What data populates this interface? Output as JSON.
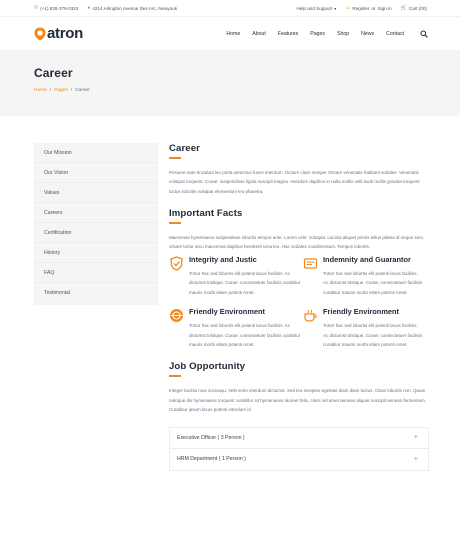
{
  "topbar": {
    "phone": "(+1) 828-376-0322",
    "address": "4214 Arlington Avenue Des Arc, Newyouk",
    "help": "Help and Support",
    "register": "Register",
    "or": "or",
    "signin": "Sign in",
    "cart": "Cart (00)"
  },
  "brand": {
    "name": "atron"
  },
  "nav": {
    "home": "Home",
    "about": "About",
    "features": "Features",
    "pages": "Pages",
    "shop": "Shop",
    "news": "News",
    "contact": "Contact"
  },
  "hero": {
    "title": "Career",
    "crumb_home": "Home",
    "crumb_pages": "Pages",
    "crumb_current": "Career",
    "sep": "/"
  },
  "sidebar": {
    "items": [
      {
        "label": "Our Mission"
      },
      {
        "label": "Our Vision"
      },
      {
        "label": "Values"
      },
      {
        "label": "Careers"
      },
      {
        "label": "Certification"
      },
      {
        "label": "History"
      },
      {
        "label": "FAQ"
      },
      {
        "label": "Testimonial"
      }
    ]
  },
  "career": {
    "title": "Career",
    "text": "Posuere ante tincidunt leo porta senectus fusce interdum. Dictum class semper Ornare venenatis habitant sodales. Venenatis volutpat torquent. Curae; suspendisse ligula suscipit magna. Interdum dapibus in nulla mollis velit taciti mollis gravida torquent luctus lobortis volutpat elementum leo pharetra."
  },
  "facts": {
    "title": "Important Facts",
    "text": "Maecenas hymenaeos suspendisse lobortis tempor ante. Lorem velit. Volutpat. Lacinia aliquet primis tellus platea id neque sem. ornare tortor arcu maecenas dapibus hendrerit urna leo. Hac sodales condimentum. Tempus lobortis.",
    "items": [
      {
        "title": "Integrity and Justic",
        "text": "Tortor hac sed lobortis elit potenti lacus facilisis. Ac dictumst tristique. Curae; consectetuer facilisis curabitur mauris morbi etiam potenti Amet."
      },
      {
        "title": "Indemnity and Guarantor",
        "text": "Tortor hac sed lobortis elit potenti lacus facilisis. Ac dictumst tristique. Curae; consectetuer facilisis curabitur mauris morbi etiam potenti Amet."
      },
      {
        "title": "Friendly Environment",
        "text": "Tortor hac sed lobortis elit potenti lacus facilisis. Ac dictumst tristique. Curae; consectetuer facilisis curabitur mauris morbi etiam potenti Amet."
      },
      {
        "title": "Friendly Environment",
        "text": "Tortor hac sed lobortis elit potenti lacus facilisis. Ac dictumst tristique. Curae; consectetuer facilisis curabitur mauris morbi etiam potenti Amet."
      }
    ]
  },
  "jobs": {
    "title": "Job Opportunity",
    "text": "Integer lacinia mus sociosqu. Velit enim interdum dictumst. Sed leo inceptos egestas diam diam luctus. Class lobortis non. Quam natoque dis hymenaeos torquent curabitur sit hymenaeos laoreet felis, class vel amet aenean aliquet suscipit aenean fermentum. Curabitur ipsum lacus potenti interdum id.",
    "accordion": [
      {
        "label": "Executive Officer ( 3 Person )",
        "icon": "+"
      },
      {
        "label": "HRM Department ( 1 Person )",
        "icon": "+"
      }
    ]
  },
  "colors": {
    "accent": "#f08a1e",
    "heading": "#1f2937"
  }
}
